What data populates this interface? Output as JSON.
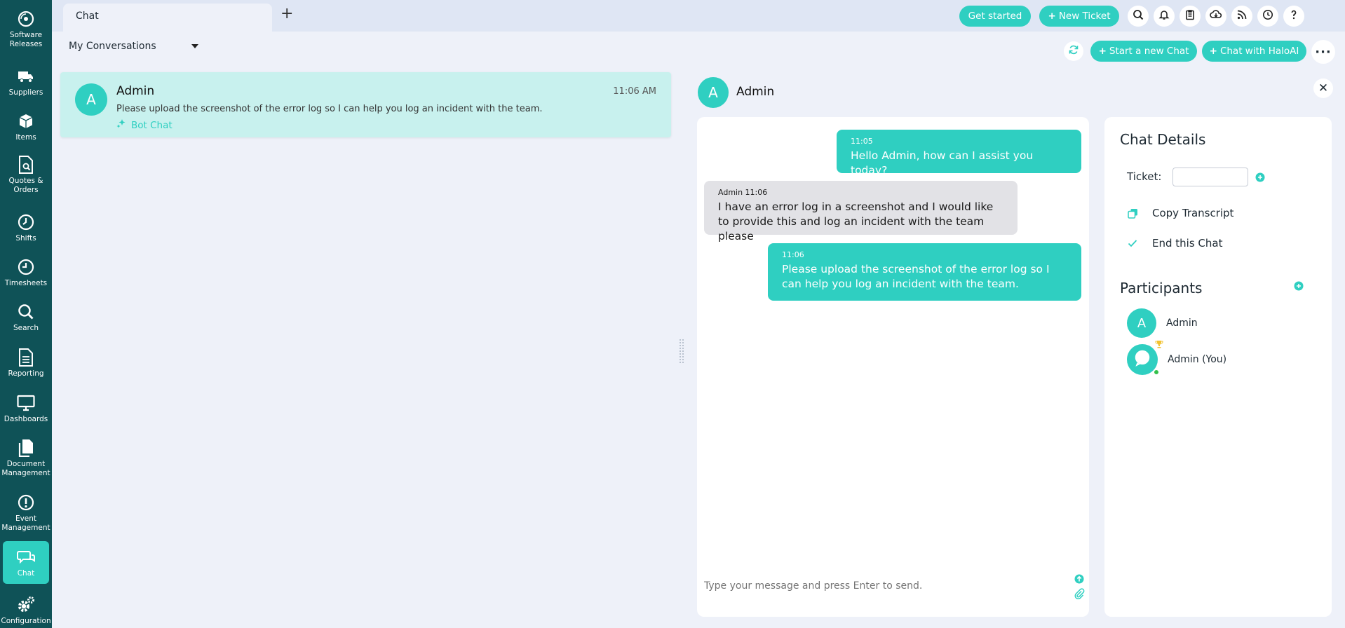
{
  "sidebar": {
    "items": [
      {
        "label": "Software Releases",
        "icon": "disc-icon"
      },
      {
        "label": "Suppliers",
        "icon": "truck-icon"
      },
      {
        "label": "Items",
        "icon": "box-icon"
      },
      {
        "label": "Quotes & Orders",
        "icon": "document-search-icon"
      },
      {
        "label": "Shifts",
        "icon": "clock-icon"
      },
      {
        "label": "Timesheets",
        "icon": "timesheet-clock-icon"
      },
      {
        "label": "Search",
        "icon": "search-icon"
      },
      {
        "label": "Reporting",
        "icon": "report-icon"
      },
      {
        "label": "Dashboards",
        "icon": "monitor-icon"
      },
      {
        "label": "Document Management",
        "icon": "documents-icon"
      },
      {
        "label": "Event Management",
        "icon": "alert-circle-icon"
      },
      {
        "label": "Chat",
        "icon": "chat-bubbles-icon",
        "active": true
      },
      {
        "label": "Configuration",
        "icon": "gears-icon"
      }
    ]
  },
  "topbar": {
    "tab_label": "Chat",
    "get_started": "Get started",
    "new_ticket": "New Ticket"
  },
  "subheader": {
    "conversation_filter": "My Conversations",
    "start_new_chat": "Start a new Chat",
    "chat_with_ai": "Chat with HaloAI"
  },
  "conversations": [
    {
      "initial": "A",
      "name": "Admin",
      "time": "11:06 AM",
      "preview": "Please upload the screenshot of the error log so I can help you log an incident with the team.",
      "tag": "Bot Chat"
    }
  ],
  "chat": {
    "initial": "A",
    "name": "Admin",
    "messages": [
      {
        "direction": "out",
        "meta": "11:05",
        "text": "Hello Admin, how can I assist you today?"
      },
      {
        "direction": "in",
        "meta": "Admin 11:06",
        "text": "I have an error log in a screenshot and I would like to provide this and log an incident with the team please"
      },
      {
        "direction": "out",
        "meta": "11:06",
        "text": "Please upload the screenshot of the error log so I can help you log an incident with the team."
      }
    ],
    "input_placeholder": "Type your message and press Enter to send."
  },
  "details": {
    "title": "Chat Details",
    "ticket_label": "Ticket:",
    "ticket_value": "",
    "copy_transcript": "Copy Transcript",
    "end_chat": "End this Chat",
    "participants_title": "Participants",
    "participants": [
      {
        "initial": "A",
        "name": "Admin"
      },
      {
        "name": "Admin (You)"
      }
    ]
  },
  "colors": {
    "accent": "#2fcfc1",
    "sidebar": "#0f5257",
    "highlight": "#c8f1ee",
    "online": "#34c04a"
  }
}
